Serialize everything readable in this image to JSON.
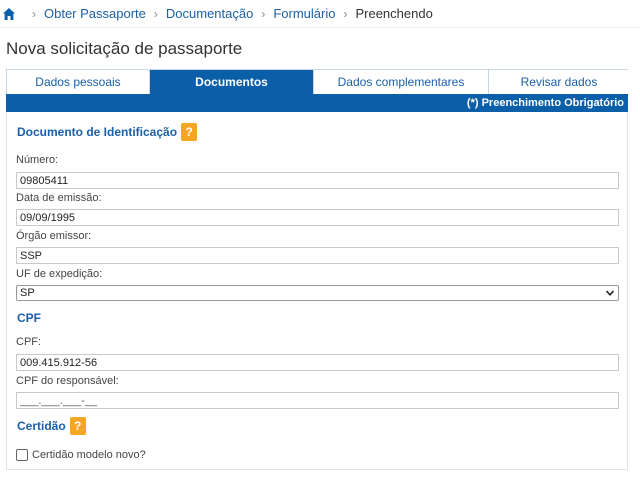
{
  "breadcrumb": {
    "home_icon": "home-icon",
    "items": [
      "Obter Passaporte",
      "Documentação",
      "Formulário"
    ],
    "current": "Preenchendo"
  },
  "page_title": "Nova solicitação de passaporte",
  "tabs": [
    {
      "label": "Dados pessoais",
      "active": false
    },
    {
      "label": "Documentos",
      "active": true
    },
    {
      "label": "Dados complementares",
      "active": false
    },
    {
      "label": "Revisar dados",
      "active": false
    }
  ],
  "required_note": "(*) Preenchimento Obrigatório",
  "sections": {
    "identificacao": {
      "title": "Documento de Identificação",
      "help": "?",
      "numero_label": "Número:",
      "numero_value": "09805411",
      "data_emissao_label": "Data de emissão:",
      "data_emissao_value": "09/09/1995",
      "orgao_label": "Órgão emissor:",
      "orgao_value": "SSP",
      "uf_label": "UF de expedição:",
      "uf_value": "SP"
    },
    "cpf": {
      "title": "CPF",
      "cpf_label": "CPF:",
      "cpf_value": "009.415.912-56",
      "responsavel_label": "CPF do responsável:",
      "responsavel_placeholder": "___.___.___-__"
    },
    "certidao": {
      "title": "Certidão",
      "help": "?",
      "checkbox_label": "Certidão modelo novo?"
    }
  },
  "colors": {
    "primary": "#0b5ea8",
    "link": "#1a5fa8",
    "help_badge": "#f5a623"
  }
}
